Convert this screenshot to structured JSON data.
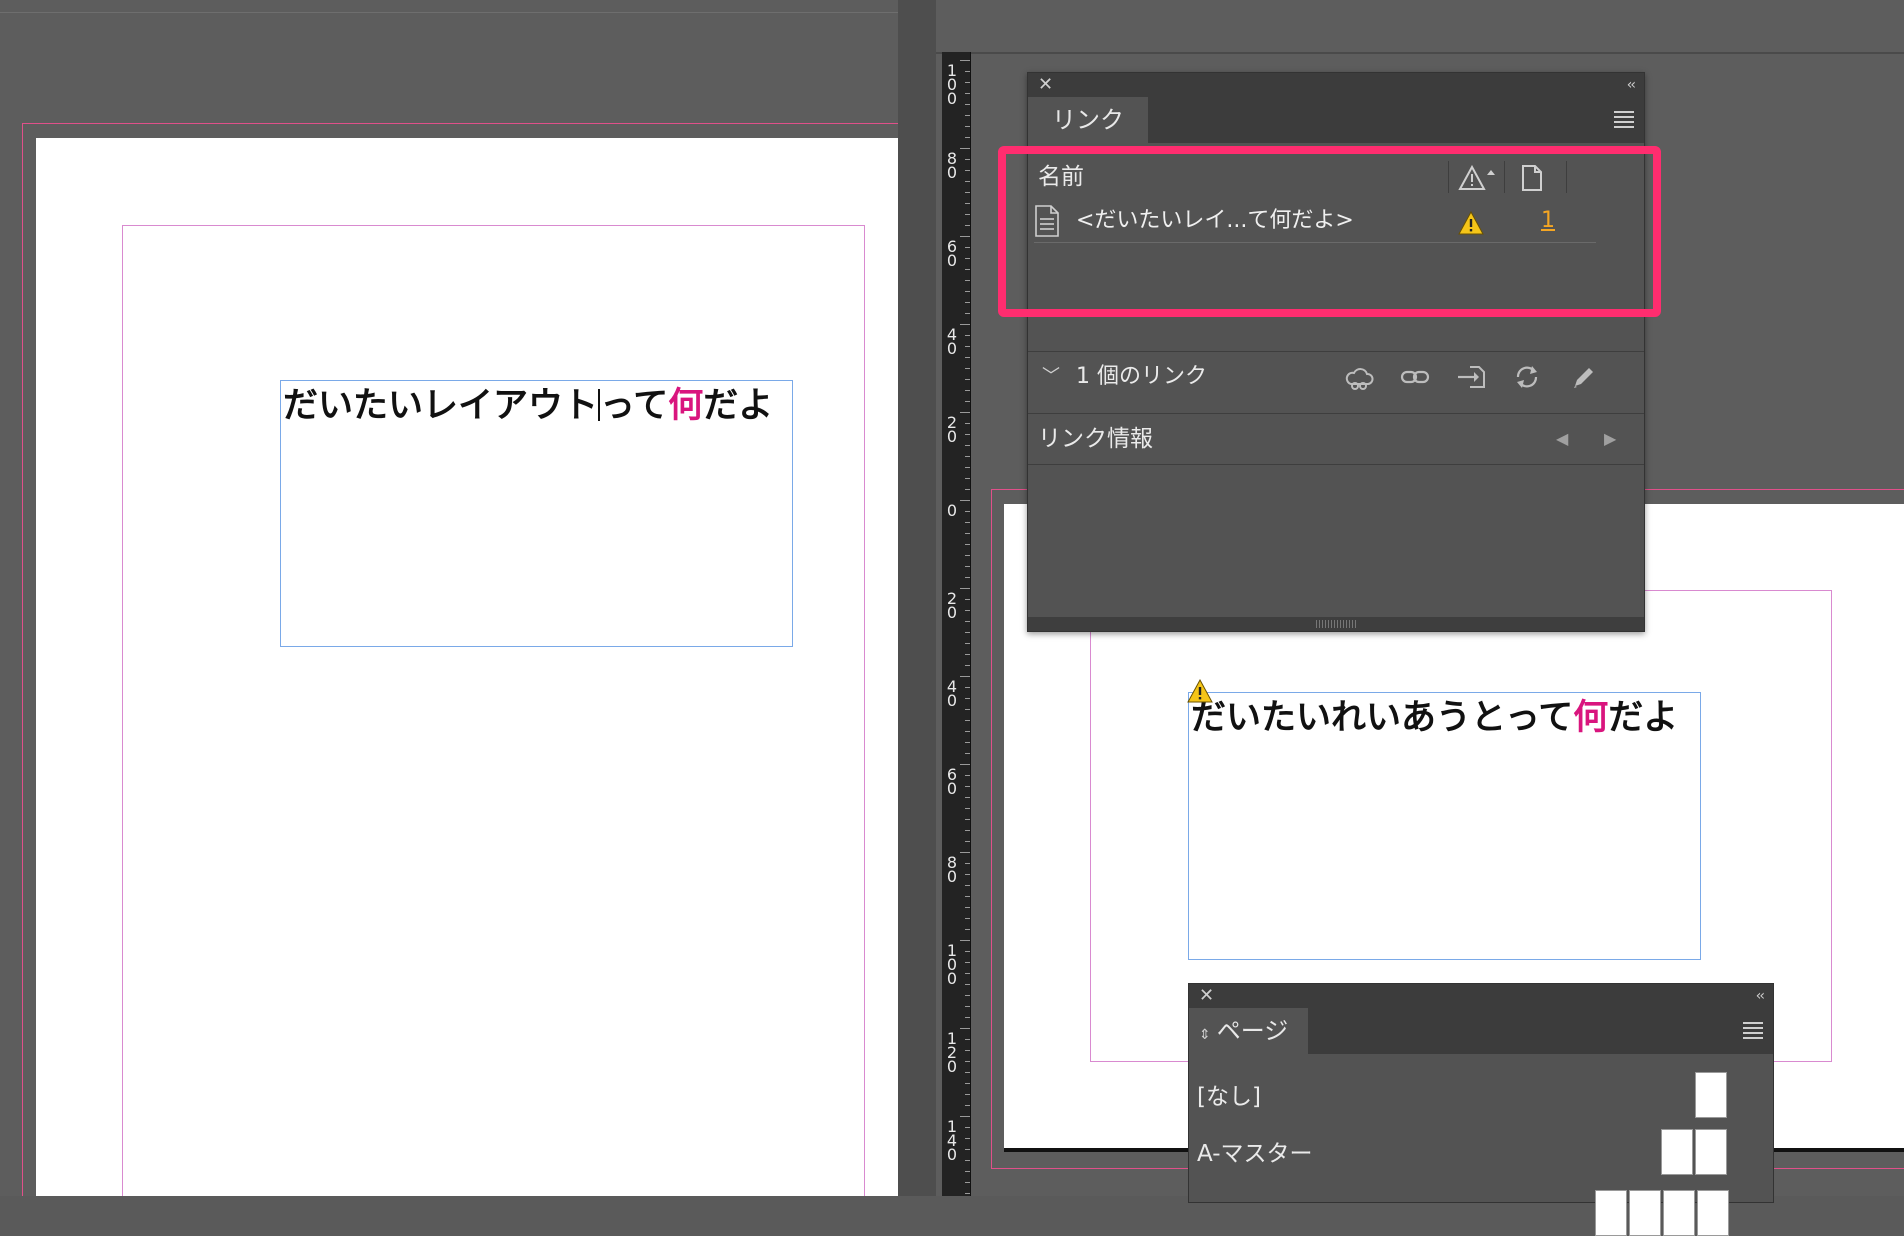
{
  "left_document": {
    "text_before_cursor": "だいたいレイアウト",
    "text_after_cursor": "って",
    "accent_char": "何",
    "text_end": "だよ"
  },
  "right_document": {
    "text_main": "だいたいれいあうとって",
    "accent_char": "何",
    "text_end": "だよ"
  },
  "vertical_ruler": {
    "labels": [
      "100",
      "80",
      "60",
      "40",
      "20",
      "0",
      "20",
      "40",
      "60",
      "80",
      "100",
      "120",
      "140"
    ]
  },
  "links_panel": {
    "close_glyph": "✕",
    "collapse_glyph": "‹‹",
    "tab_label": "リンク",
    "column_name_header": "名前",
    "rows": [
      {
        "name": "<だいたいレイ...て何だよ>",
        "page": "1",
        "status": "warning"
      }
    ],
    "footer_chevron": "﹀",
    "footer_count": "1 個のリンク",
    "footer_tools": [
      "cloud-link-icon",
      "relink-icon",
      "go-to-link-icon",
      "update-link-icon",
      "edit-original-icon"
    ],
    "info_title": "リンク情報",
    "info_prev": "◀",
    "info_next": "▶"
  },
  "pages_panel": {
    "close_glyph": "✕",
    "collapse_glyph": "‹‹",
    "sort_glyph": "⇕",
    "tab_label": "ページ",
    "masters": [
      "[なし]",
      "A-マスター"
    ]
  },
  "colors": {
    "accent_magenta": "#d9157e",
    "highlight_pink": "#ff2d6f",
    "warning_yellow": "#f5c518",
    "link_orange": "#f5a623",
    "frame_blue": "#7aa9e8"
  }
}
